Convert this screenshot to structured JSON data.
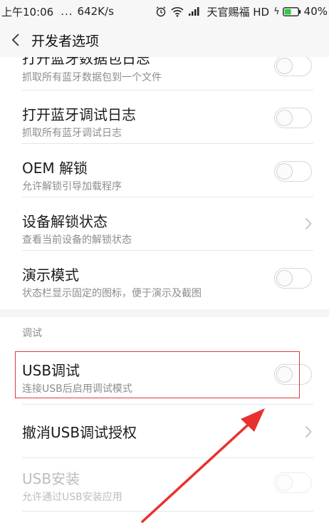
{
  "status_bar": {
    "time": "上午10:06",
    "dots": "...",
    "speed": "642K/s",
    "carrier": "天官赐福 HD",
    "battery": "40%",
    "icons": [
      "alarm-icon",
      "wifi-icon",
      "signal-icon",
      "charging-icon",
      "battery-icon"
    ]
  },
  "header": {
    "back_icon": "chevron-left-icon",
    "title": "开发者选项"
  },
  "items": [
    {
      "title": "打开蓝牙数据包日志",
      "subtitle": "抓取所有蓝牙数据包到一个文件",
      "control": "toggle",
      "on": false,
      "enabled": true
    },
    {
      "title": "打开蓝牙调试日志",
      "subtitle": "抓取所有蓝牙调试日志",
      "control": "toggle",
      "on": false,
      "enabled": true
    },
    {
      "title": "OEM 解锁",
      "subtitle": "允许解锁引导加载程序",
      "control": "toggle",
      "on": false,
      "enabled": true
    },
    {
      "title": "设备解锁状态",
      "subtitle": "查看当前设备的解锁状态",
      "control": "chevron",
      "enabled": true
    },
    {
      "title": "演示模式",
      "subtitle": "状态栏显示固定的图标，便于演示及截图",
      "control": "toggle",
      "on": false,
      "enabled": true
    }
  ],
  "debug_section": {
    "label": "调试",
    "items": [
      {
        "title": "USB调试",
        "subtitle": "连接USB后启用调试模式",
        "control": "toggle",
        "on": false,
        "enabled": true,
        "highlighted": true
      },
      {
        "title": "撤消USB调试授权",
        "subtitle": "",
        "control": "chevron",
        "enabled": true
      },
      {
        "title": "USB安装",
        "subtitle": "允许通过USB安装应用",
        "control": "toggle",
        "on": false,
        "enabled": false
      }
    ]
  },
  "colors": {
    "annotation": "#e23b3b",
    "bar_bg": "#f7f7f7",
    "section_bg": "#f5f5f5",
    "battery_green": "#2ecc40"
  }
}
